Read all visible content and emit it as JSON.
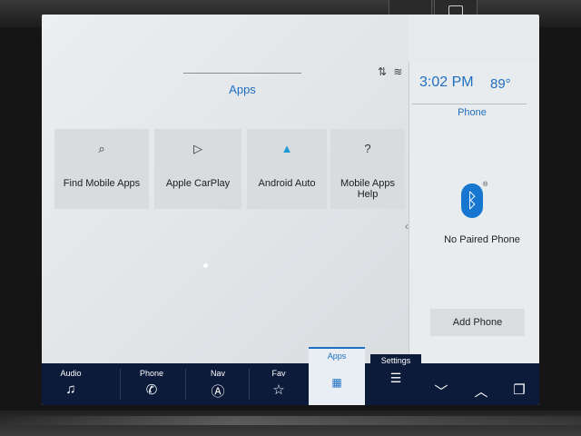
{
  "main": {
    "title": "Apps",
    "tiles": [
      {
        "label": "Find Mobile Apps",
        "icon": "search-apps-icon",
        "glyph": "⌕"
      },
      {
        "label": "Apple CarPlay",
        "icon": "carplay-icon",
        "glyph": "▷"
      },
      {
        "label": "Android Auto",
        "icon": "android-auto-icon",
        "glyph": "▲"
      },
      {
        "label": "Mobile Apps Help",
        "icon": "help-icon",
        "glyph": "?"
      }
    ]
  },
  "status": {
    "sort_glyph": "⇅",
    "signal_glyph": "≋"
  },
  "side_panel": {
    "time": "3:02 PM",
    "temperature": "89°",
    "header": "Phone",
    "bluetooth_glyph": "ᛒ",
    "message": "No Paired Phone",
    "add_button": "Add Phone"
  },
  "navbar": {
    "audio": {
      "label": "Audio",
      "glyph": "♫"
    },
    "phone": {
      "label": "Phone",
      "glyph": "✆"
    },
    "nav": {
      "label": "Nav",
      "glyph": "Ⓐ"
    },
    "fav": {
      "label": "Fav",
      "glyph": "☆"
    },
    "apps": {
      "label": "Apps",
      "glyph": "▦"
    },
    "settings": {
      "label": "Settings",
      "glyph": "☰"
    },
    "down_glyph": "﹀",
    "up_glyph": "︿",
    "multiwindow_glyph": "❐"
  },
  "colors": {
    "accent": "#1e6fc1",
    "navbar": "#0d1b3a",
    "bluetooth": "#1777d0"
  }
}
